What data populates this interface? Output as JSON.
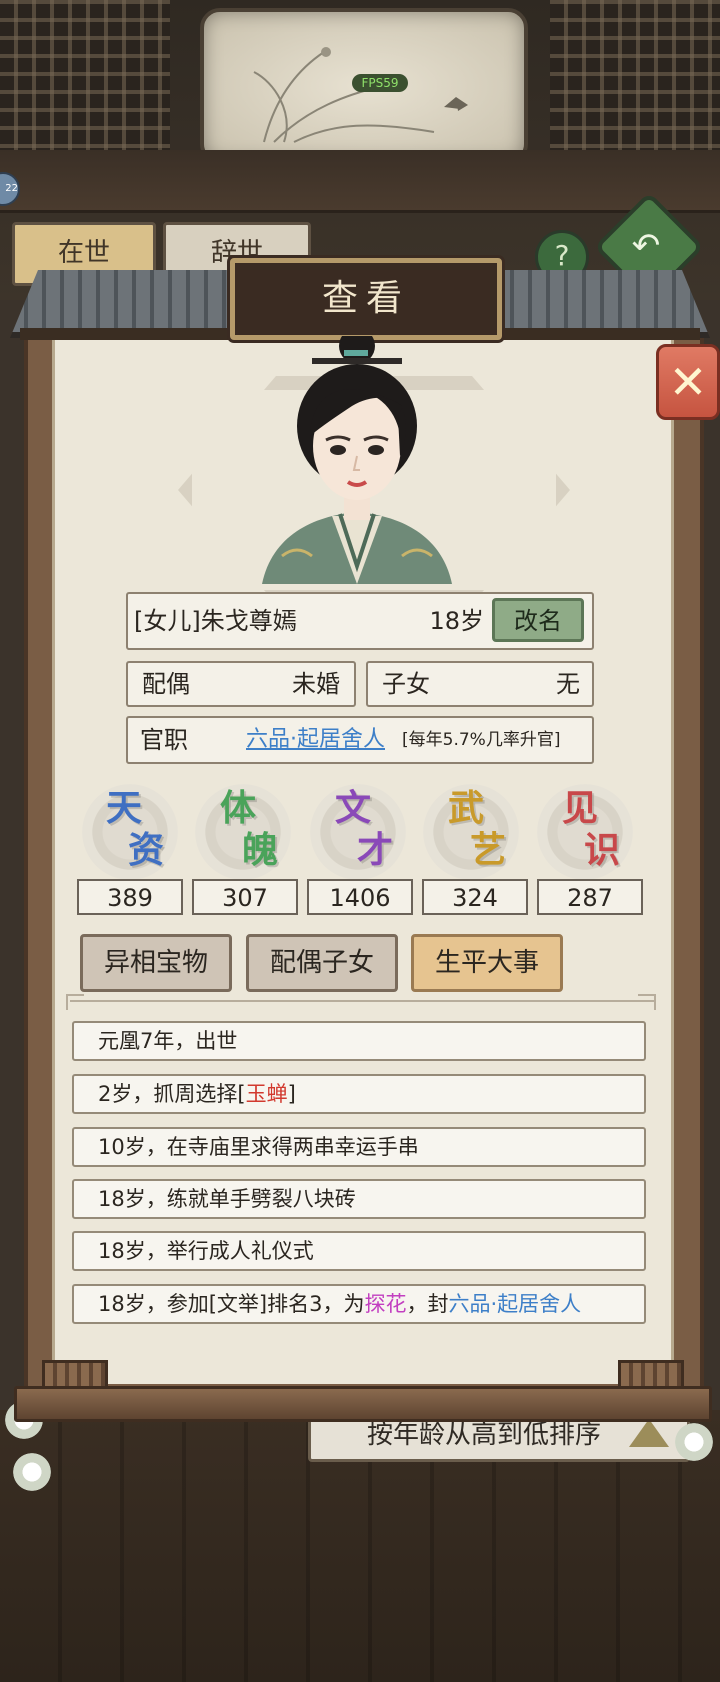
{
  "hud": {
    "fps": "FPS59",
    "side_badge": "22"
  },
  "background": {
    "tabs": [
      "在世",
      "辞世"
    ],
    "help": "?",
    "sort_label": "按年龄从高到低排序"
  },
  "dialog": {
    "title": "查看",
    "close": "✕",
    "name": "[女儿]朱戈尊嫣",
    "age": "18岁",
    "rename": "改名",
    "spouse_label": "配偶",
    "spouse_value": "未婚",
    "children_label": "子女",
    "children_value": "无",
    "office_label": "官职",
    "office_value": "六品·起居舍人",
    "office_note": "[每年5.7%几率升官]",
    "stats": [
      {
        "chars": [
          "天",
          "资"
        ],
        "value": "389",
        "color": "#3f6fc2"
      },
      {
        "chars": [
          "体",
          "魄"
        ],
        "value": "307",
        "color": "#4aa35a"
      },
      {
        "chars": [
          "文",
          "才"
        ],
        "value": "1406",
        "color": "#8a49b8"
      },
      {
        "chars": [
          "武",
          "艺"
        ],
        "value": "324",
        "color": "#c99a2a"
      },
      {
        "chars": [
          "见",
          "识"
        ],
        "value": "287",
        "color": "#c8484a"
      }
    ],
    "tabs": [
      "异相宝物",
      "配偶子女",
      "生平大事"
    ],
    "events": {
      "e1": "元凰7年，出世",
      "e2a": "2岁，抓周选择",
      "e2b": "[",
      "e2c": "玉蝉",
      "e2d": "]",
      "e3": "10岁，在寺庙里求得两串幸运手串",
      "e4": "18岁，练就单手劈裂八块砖",
      "e5": "18岁，举行成人礼仪式",
      "e6a": "18岁，参加[文举]排名3，为",
      "e6b": "探花",
      "e6c": "，封",
      "e6d": "六品·起居舍人"
    }
  }
}
